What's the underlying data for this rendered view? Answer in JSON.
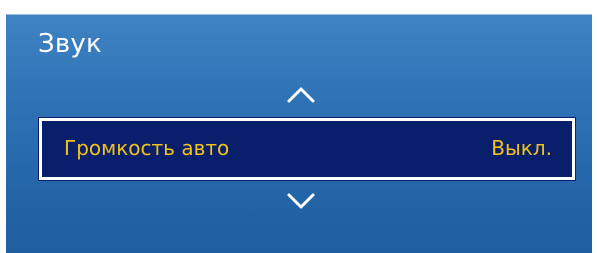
{
  "menu": {
    "title": "Звук",
    "selected_item": {
      "label": "Громкость авто",
      "value": "Выкл."
    },
    "colors": {
      "panel_top": "#3f83c4",
      "panel_bottom": "#1f5e9f",
      "highlight_bg": "#0a1f6b",
      "highlight_border": "#ffffff",
      "highlight_text": "#f2c21a",
      "title_text": "#ffffff"
    },
    "icons": {
      "up": "chevron-up-icon",
      "down": "chevron-down-icon"
    }
  }
}
